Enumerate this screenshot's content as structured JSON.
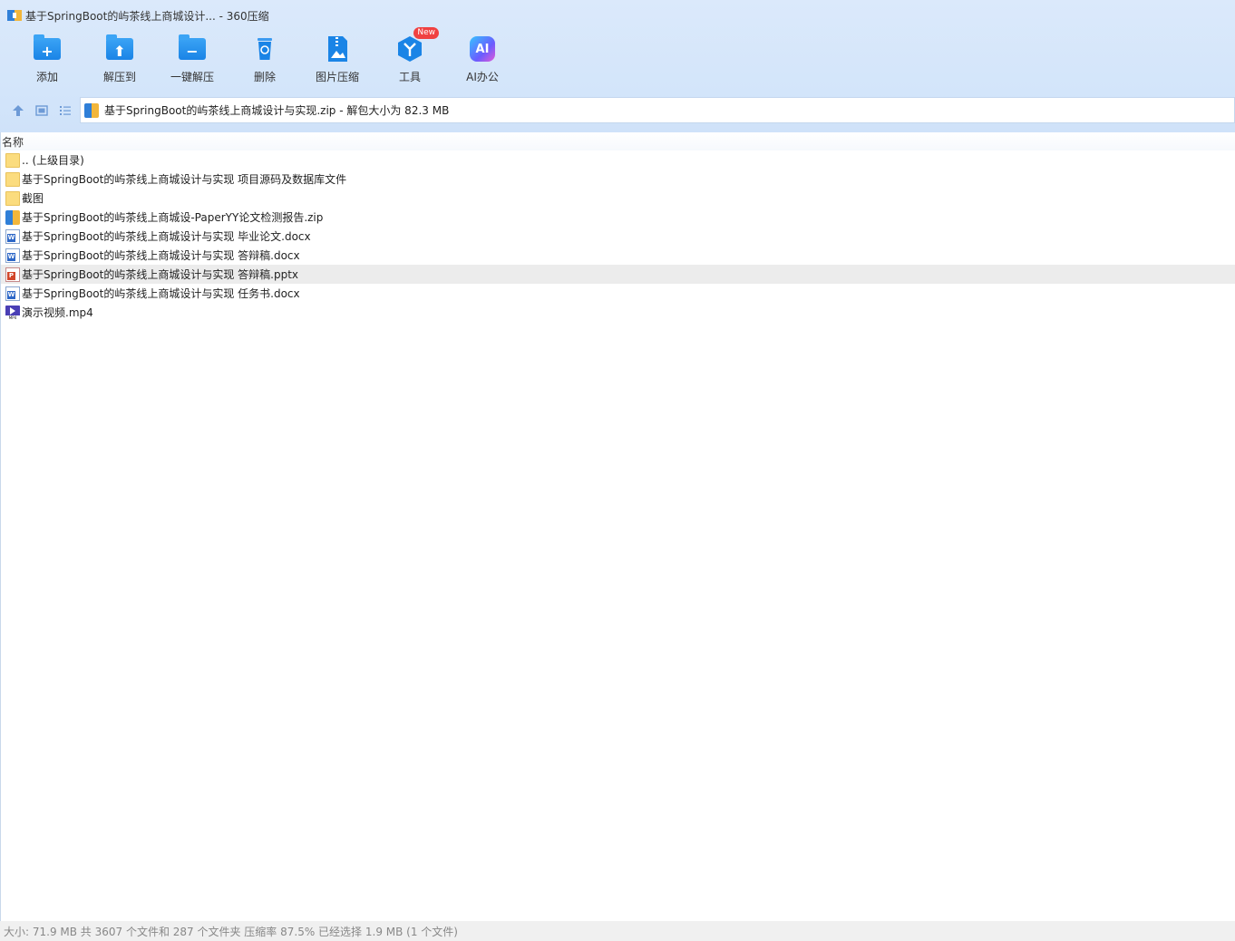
{
  "window": {
    "title": "基于SpringBoot的屿茶线上商城设计... - 360压缩"
  },
  "toolbar": {
    "items": [
      {
        "label": "添加",
        "icon": "add-folder-icon"
      },
      {
        "label": "解压到",
        "icon": "extract-to-icon"
      },
      {
        "label": "一键解压",
        "icon": "one-click-extract-icon"
      },
      {
        "label": "删除",
        "icon": "trash-icon"
      },
      {
        "label": "图片压缩",
        "icon": "image-compress-icon"
      },
      {
        "label": "工具",
        "icon": "tools-icon",
        "badge": "New"
      },
      {
        "label": "AI办公",
        "icon": "ai-office-icon",
        "glyph": "AI"
      }
    ]
  },
  "addressbar": {
    "path": "基于SpringBoot的屿茶线上商城设计与实现.zip - 解包大小为 82.3 MB"
  },
  "list": {
    "column_name": "名称",
    "rows": [
      {
        "name": ".. (上级目录)",
        "type": "folder"
      },
      {
        "name": "基于SpringBoot的屿茶线上商城设计与实现 项目源码及数据库文件",
        "type": "folder"
      },
      {
        "name": "截图",
        "type": "folder"
      },
      {
        "name": "基于SpringBoot的屿茶线上商城设-PaperYY论文检测报告.zip",
        "type": "zip"
      },
      {
        "name": "基于SpringBoot的屿茶线上商城设计与实现 毕业论文.docx",
        "type": "docx",
        "badge": "W"
      },
      {
        "name": "基于SpringBoot的屿茶线上商城设计与实现 答辩稿.docx",
        "type": "docx",
        "badge": "W"
      },
      {
        "name": "基于SpringBoot的屿茶线上商城设计与实现 答辩稿.pptx",
        "type": "pptx",
        "badge": "P"
      },
      {
        "name": "基于SpringBoot的屿茶线上商城设计与实现 任务书.docx",
        "type": "docx",
        "badge": "W"
      },
      {
        "name": "演示视频.mp4",
        "type": "mp4",
        "tag": "MP4"
      }
    ],
    "selected_index": 6
  },
  "status": {
    "text": "大小: 71.9 MB 共 3607 个文件和 287 个文件夹 压缩率 87.5% 已经选择 1.9 MB (1 个文件)"
  },
  "colors": {
    "accent": "#1a84e6",
    "header_bg": "#d3e5fa",
    "selected_row": "#ececec"
  }
}
